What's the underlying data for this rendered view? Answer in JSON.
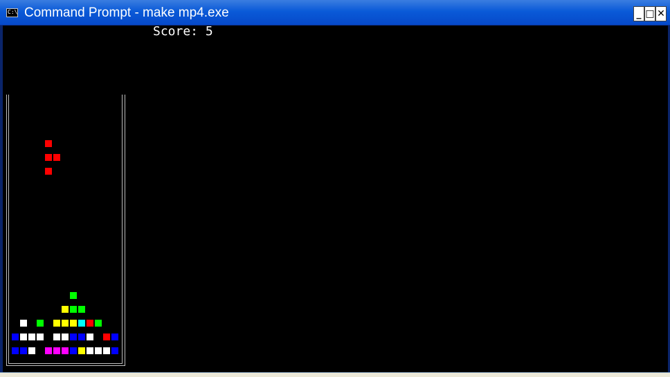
{
  "window": {
    "title": "Command Prompt - make mp4.exe",
    "icon_name": "cmd-icon",
    "icon_text": "C:\\",
    "buttons": {
      "minimize": "_",
      "maximize": "□",
      "close": "✕"
    }
  },
  "console": {
    "score_text": "Score: 5"
  },
  "colors": {
    "R": "#ff0000",
    "G": "#00ff00",
    "Y": "#ffff00",
    "W": "#ffffff",
    "B": "#0000ff",
    "C": "#00ffff",
    "M": "#ff00ff"
  },
  "board": {
    "columns": 8,
    "rows": 10,
    "falling_piece": {
      "color": "R",
      "cells": [
        [
          3,
          3
        ],
        [
          3,
          4
        ],
        [
          4,
          4
        ],
        [
          3,
          5
        ]
      ]
    },
    "stack": [
      {
        "row": 6,
        "cells": [
          [
            7,
            "G"
          ]
        ]
      },
      {
        "row": 7,
        "cells": [
          [
            6,
            "Y"
          ],
          [
            7,
            "G"
          ],
          [
            8,
            "G"
          ]
        ]
      },
      {
        "row": 8,
        "cells": [
          [
            1,
            "W"
          ],
          [
            3,
            "G"
          ],
          [
            5,
            "Y"
          ],
          [
            6,
            "Y"
          ],
          [
            7,
            "Y"
          ],
          [
            8,
            "C"
          ],
          [
            9,
            "R"
          ],
          [
            10,
            "G"
          ]
        ]
      },
      {
        "row": 9,
        "cells": [
          [
            0,
            "B"
          ],
          [
            1,
            "W"
          ],
          [
            2,
            "W"
          ],
          [
            3,
            "W"
          ],
          [
            5,
            "W"
          ],
          [
            6,
            "W"
          ],
          [
            7,
            "B"
          ],
          [
            8,
            "B"
          ],
          [
            9,
            "W"
          ],
          [
            11,
            "R"
          ],
          [
            12,
            "B"
          ]
        ]
      },
      {
        "row": 10,
        "cells": [
          [
            0,
            "B"
          ],
          [
            1,
            "B"
          ],
          [
            2,
            "W"
          ],
          [
            4,
            "M"
          ],
          [
            5,
            "M"
          ],
          [
            6,
            "M"
          ],
          [
            7,
            "B"
          ],
          [
            8,
            "Y"
          ],
          [
            9,
            "W"
          ],
          [
            10,
            "W"
          ],
          [
            11,
            "W"
          ],
          [
            12,
            "B"
          ]
        ]
      }
    ]
  }
}
